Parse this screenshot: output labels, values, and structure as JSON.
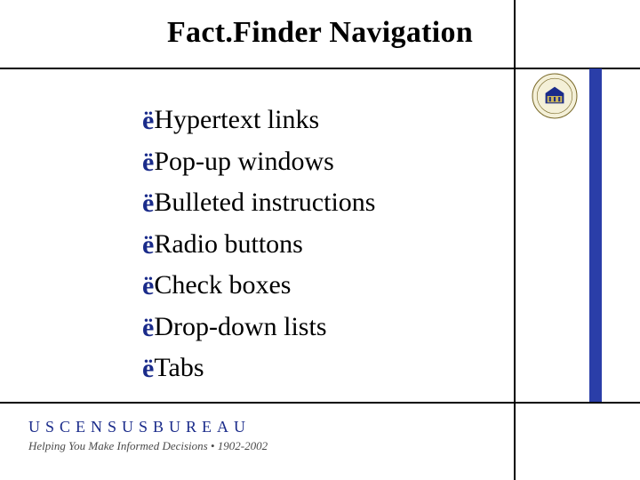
{
  "title": "Fact.Finder Navigation",
  "bullets": [
    "Hypertext links",
    "Pop-up windows",
    "Bulleted instructions",
    "Radio buttons",
    "Check boxes",
    "Drop-down lists",
    "Tabs"
  ],
  "footer": {
    "brand": "USCENSUSBUREAU",
    "tagline": "Helping You Make Informed Decisions",
    "sep": "•",
    "years": "1902-2002"
  },
  "seal_label": "Department of Commerce seal"
}
